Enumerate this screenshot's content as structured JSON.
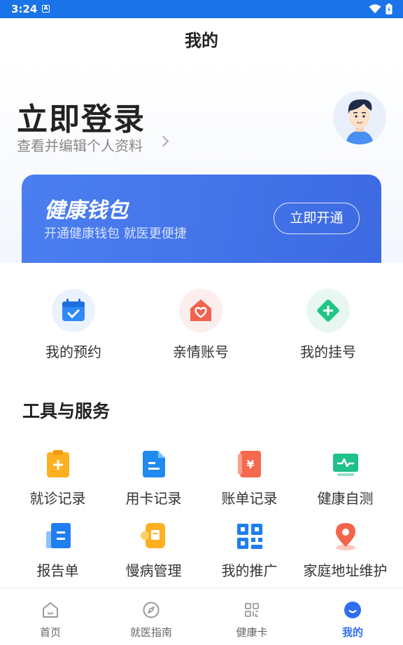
{
  "status_bar": {
    "time": "3:24"
  },
  "header": {
    "title": "我的"
  },
  "profile": {
    "login_title": "立即登录",
    "login_sub": "查看并编辑个人资料"
  },
  "wallet": {
    "title": "健康钱包",
    "subtitle": "开通健康钱包 就医更便捷",
    "button": "立即开通"
  },
  "quick_actions": [
    {
      "label": "我的预约",
      "icon": "calendar-icon"
    },
    {
      "label": "亲情账号",
      "icon": "heart-house-icon"
    },
    {
      "label": "我的挂号",
      "icon": "register-icon"
    }
  ],
  "tools": {
    "title": "工具与服务",
    "items": [
      {
        "label": "就诊记录",
        "icon": "clipboard-plus-icon"
      },
      {
        "label": "用卡记录",
        "icon": "card-file-icon"
      },
      {
        "label": "账单记录",
        "icon": "yen-bill-icon"
      },
      {
        "label": "健康自测",
        "icon": "monitor-pulse-icon"
      },
      {
        "label": "报告单",
        "icon": "report-icon"
      },
      {
        "label": "慢病管理",
        "icon": "chronic-icon"
      },
      {
        "label": "我的推广",
        "icon": "qrcode-icon"
      },
      {
        "label": "家庭地址维护",
        "icon": "location-pin-icon"
      }
    ]
  },
  "tabbar": [
    {
      "label": "首页",
      "icon": "home-icon"
    },
    {
      "label": "就医指南",
      "icon": "compass-icon"
    },
    {
      "label": "健康卡",
      "icon": "card-grid-icon"
    },
    {
      "label": "我的",
      "icon": "profile-icon"
    }
  ],
  "colors": {
    "status_bar": "#1a73e8",
    "wallet": "#4175e8",
    "tab_active": "#2f6ef0"
  }
}
